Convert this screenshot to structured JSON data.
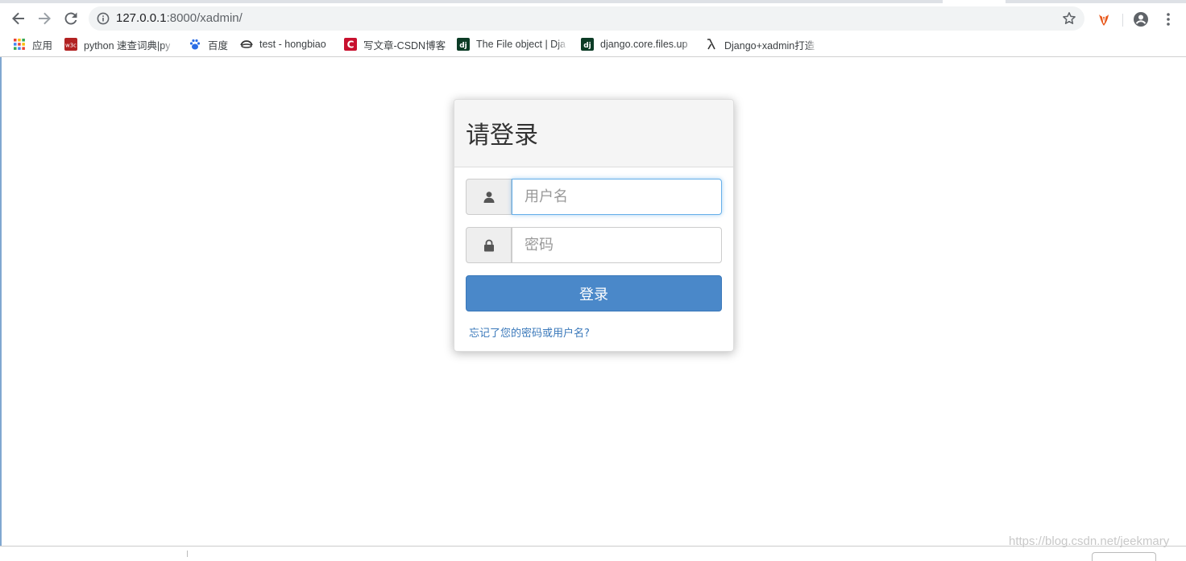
{
  "browser": {
    "url_host": "127.0.0.1",
    "url_rest": ":8000/xadmin/",
    "bookmarks": [
      {
        "icon": "apps-grid-icon",
        "label": "应用"
      },
      {
        "icon": "w3c-icon",
        "label": "python 速查词典|py"
      },
      {
        "icon": "baidu-paw-icon",
        "label": "百度"
      },
      {
        "icon": "hat-icon",
        "label": "test - hongbiao"
      },
      {
        "icon": "csdn-icon",
        "label": "写文章-CSDN博客"
      },
      {
        "icon": "django-icon",
        "label": "The File object | Dja"
      },
      {
        "icon": "django-icon",
        "label": "django.core.files.up"
      },
      {
        "icon": "lambda-icon",
        "label": "Django+xadmin打造"
      }
    ]
  },
  "login": {
    "title": "请登录",
    "username_placeholder": "用户名",
    "password_placeholder": "密码",
    "submit_label": "登录",
    "forgot_link": "忘记了您的密码或用户名?"
  },
  "watermark": "https://blog.csdn.net/jeekmary",
  "colors": {
    "primary": "#4a88c9",
    "link": "#3a78ba",
    "focus": "#66afe9"
  }
}
